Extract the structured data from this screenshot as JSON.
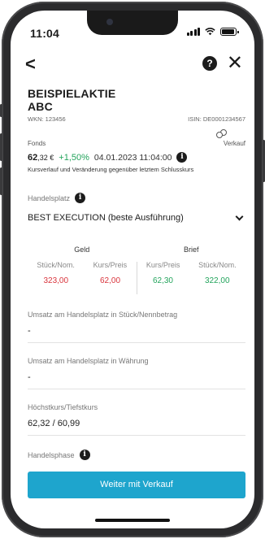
{
  "status": {
    "time": "11:04"
  },
  "nav": {
    "back": "<",
    "help": "?",
    "close": "✕"
  },
  "instrument": {
    "name_line1": "BEISPIELAKTIE",
    "name_line2": "ABC",
    "wkn": "WKN: 123456",
    "isin": "ISIN: DE0001234567",
    "type": "Fonds",
    "action": "Verkauf",
    "price": "62",
    "price_decimals": ",32 €",
    "change": "+1,50%",
    "datetime": "04.01.2023 11:04:00",
    "note": "Kursverlauf und Veränderung gegenüber letztem Schlusskurs"
  },
  "venue": {
    "label": "Handelsplatz",
    "selected": "BEST EXECUTION (beste Ausführung)"
  },
  "quote": {
    "bid": {
      "title": "Geld",
      "col1": "Stück/Nom.",
      "col2": "Kurs/Preis",
      "qty": "323,00",
      "price": "62,00"
    },
    "ask": {
      "title": "Brief",
      "col1": "Kurs/Preis",
      "col2": "Stück/Nom.",
      "price": "62,30",
      "qty": "322,00"
    }
  },
  "fields": {
    "volume_units_label": "Umsatz am Handelsplatz in Stück/Nennbetrag",
    "volume_units_value": "-",
    "volume_currency_label": "Umsatz am Handelsplatz in Währung",
    "volume_currency_value": "-",
    "high_low_label": "Höchstkurs/Tiefstkurs",
    "high_low_value": "62,32 / 60,99",
    "phase_label": "Handelsphase"
  },
  "cta": {
    "label": "Weiter mit Verkauf"
  },
  "colors": {
    "accent": "#1ea5cd",
    "positive": "#23a45c",
    "negative": "#d9343c"
  },
  "icons": [
    "back-icon",
    "help-icon",
    "close-icon",
    "info-icon",
    "coins-icon",
    "chevron-down-icon"
  ]
}
